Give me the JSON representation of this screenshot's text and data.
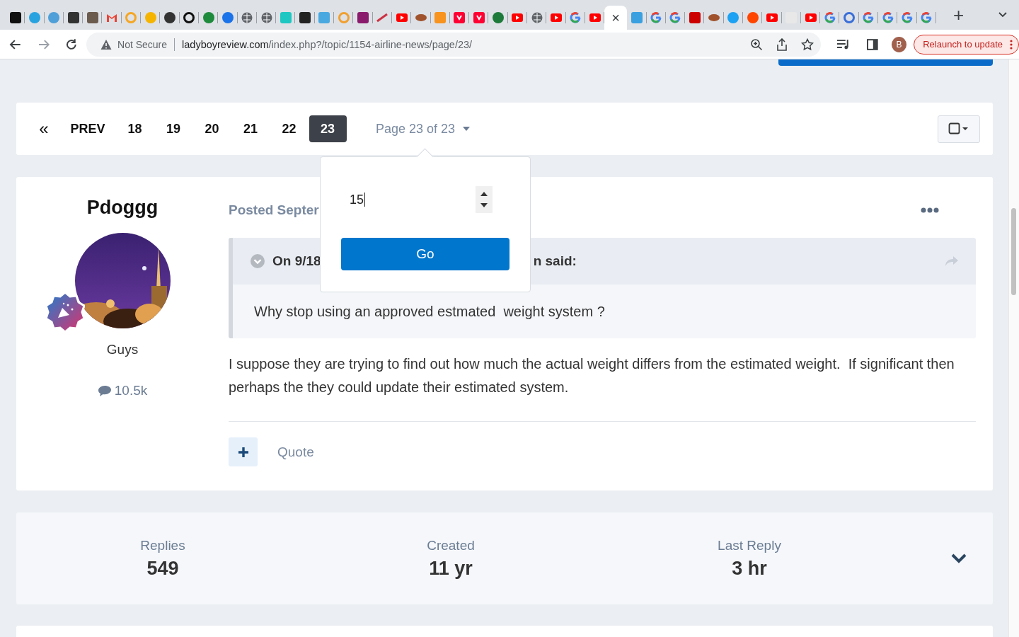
{
  "tabs": [
    {
      "kind": "square",
      "color": "#111111",
      "selected": false
    },
    {
      "kind": "circle",
      "color": "#29a3e0",
      "selected": false
    },
    {
      "kind": "circle",
      "color": "#4f9fd8",
      "selected": false
    },
    {
      "kind": "square",
      "color": "#333333",
      "selected": false
    },
    {
      "kind": "square",
      "color": "#6b5a4e",
      "selected": false
    },
    {
      "kind": "mail",
      "color": "#ea4335",
      "selected": false
    },
    {
      "kind": "ring",
      "color": "#f5a623",
      "selected": false
    },
    {
      "kind": "circle",
      "color": "#f5b400",
      "selected": false
    },
    {
      "kind": "circle",
      "color": "#333333",
      "selected": false
    },
    {
      "kind": "ring",
      "color": "#111111",
      "selected": false
    },
    {
      "kind": "circle",
      "color": "#1e8a3c",
      "selected": false
    },
    {
      "kind": "circle",
      "color": "#1a73e8",
      "selected": false
    },
    {
      "kind": "globe",
      "color": "#5f6368",
      "selected": false
    },
    {
      "kind": "globe",
      "color": "#5f6368",
      "selected": false
    },
    {
      "kind": "square",
      "color": "#1fc7c2",
      "selected": false
    },
    {
      "kind": "square",
      "color": "#222222",
      "selected": false
    },
    {
      "kind": "square",
      "color": "#4aa8e0",
      "selected": false
    },
    {
      "kind": "ring",
      "color": "#f0a030",
      "selected": false
    },
    {
      "kind": "square",
      "color": "#8a1b6c",
      "selected": false
    },
    {
      "kind": "line",
      "color": "#cc3344",
      "selected": false
    },
    {
      "kind": "play",
      "color": "#ff0000",
      "selected": false
    },
    {
      "kind": "ball",
      "color": "#a0522d",
      "selected": false
    },
    {
      "kind": "square",
      "color": "#f7931e",
      "selected": false
    },
    {
      "kind": "down",
      "color": "#ff0033",
      "selected": false
    },
    {
      "kind": "down",
      "color": "#ff0033",
      "selected": false
    },
    {
      "kind": "circle",
      "color": "#1d7a3a",
      "selected": false
    },
    {
      "kind": "play",
      "color": "#ff0000",
      "selected": false
    },
    {
      "kind": "globe",
      "color": "#5f6368",
      "selected": false
    },
    {
      "kind": "play",
      "color": "#ff0000",
      "selected": false
    },
    {
      "kind": "google",
      "selected": false
    },
    {
      "kind": "play",
      "color": "#ff0000",
      "selected": false
    },
    {
      "kind": "close",
      "color": "#3c4043",
      "selected": true,
      "glyph": "×"
    },
    {
      "kind": "square",
      "color": "#3aa0e0",
      "selected": false
    },
    {
      "kind": "google",
      "selected": false
    },
    {
      "kind": "google",
      "selected": false
    },
    {
      "kind": "square",
      "color": "#cc0000",
      "selected": false
    },
    {
      "kind": "ball",
      "color": "#a0522d",
      "selected": false
    },
    {
      "kind": "circle",
      "color": "#1da1f2",
      "selected": false
    },
    {
      "kind": "circle",
      "color": "#ff4500",
      "selected": false
    },
    {
      "kind": "play",
      "color": "#ff0000",
      "selected": false
    },
    {
      "kind": "square",
      "color": "#e8e8e8",
      "selected": false
    },
    {
      "kind": "play",
      "color": "#ff0000",
      "selected": false
    },
    {
      "kind": "google",
      "selected": false
    },
    {
      "kind": "ring",
      "color": "#3b6fd8",
      "selected": false
    },
    {
      "kind": "google",
      "selected": false
    },
    {
      "kind": "google",
      "selected": false
    },
    {
      "kind": "google",
      "selected": false
    },
    {
      "kind": "google",
      "selected": false
    }
  ],
  "new_tab": "+",
  "address": {
    "security": "Not Secure",
    "host": "ladyboyreview.com",
    "path": "/index.php?/topic/1154-airline-news/page/23/"
  },
  "profile": "B",
  "relaunch": "Relaunch to update",
  "pagination": {
    "first": "«",
    "prev": "PREV",
    "pages": [
      {
        "label": "18",
        "selected": false
      },
      {
        "label": "19",
        "selected": false
      },
      {
        "label": "20",
        "selected": false
      },
      {
        "label": "21",
        "selected": false
      },
      {
        "label": "22",
        "selected": false
      },
      {
        "label": "23",
        "selected": true
      }
    ],
    "page_of": "Page 23 of 23"
  },
  "jump_popup": {
    "value": "15",
    "button": "Go"
  },
  "post": {
    "author": "Pdoggg",
    "group": "Guys",
    "posts": "10.5k",
    "date": "Posted Septer",
    "quote": {
      "header_start": "On 9/18",
      "header_end": "n said:",
      "text": "Why stop using an approved estmated  weight system ?"
    },
    "body": "I suppose they are trying to find out how much the actual weight differs from the estimated weight.  If significant then perhaps the they could update their estimated system.",
    "quote_button": "Quote"
  },
  "stats": [
    {
      "label": "Replies",
      "value": "549"
    },
    {
      "label": "Created",
      "value": "11 yr"
    },
    {
      "label": "Last Reply",
      "value": "3 hr"
    }
  ]
}
